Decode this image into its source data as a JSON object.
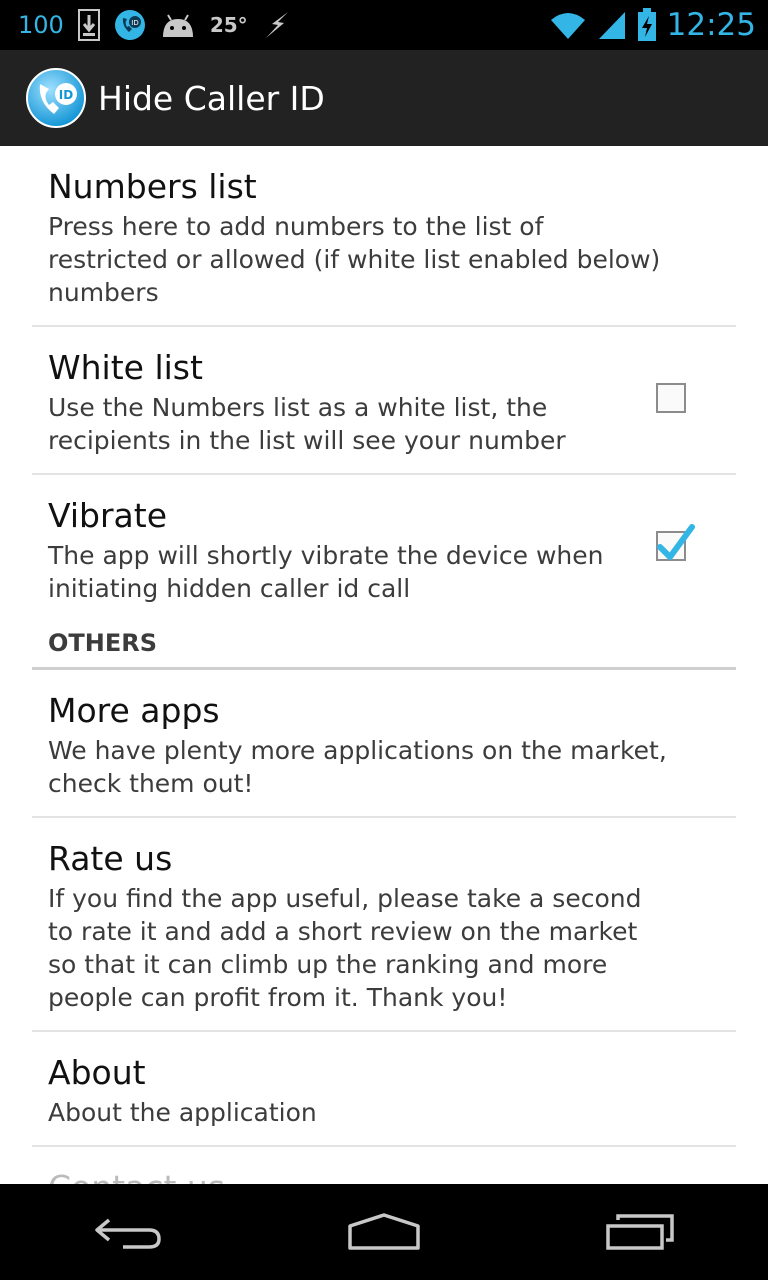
{
  "status_bar": {
    "battery_level_text": "100",
    "temperature": "25°",
    "time": "12:25",
    "icons": [
      "battery-100-icon",
      "download-icon",
      "caller-id-notify-icon",
      "android-icon",
      "weather-temp",
      "lightning-icon",
      "wifi-icon",
      "signal-icon",
      "battery-charging-icon"
    ]
  },
  "action_bar": {
    "title": "Hide Caller ID",
    "icon": "caller-id-app-icon"
  },
  "preferences": {
    "numbers_list": {
      "title": "Numbers list",
      "summary": "Press here to add numbers to the list of restricted or allowed (if white list enabled below) numbers"
    },
    "white_list": {
      "title": "White list",
      "summary": "Use the Numbers list as a white list, the recipients in the list will see your number",
      "checked": false
    },
    "vibrate": {
      "title": "Vibrate",
      "summary": "The app will shortly vibrate the device when initiating hidden caller id call",
      "checked": true
    },
    "others_header": "OTHERS",
    "more_apps": {
      "title": "More apps",
      "summary": "We have plenty more applications on the market, check them out!"
    },
    "rate_us": {
      "title": "Rate us",
      "summary": "If you find the app useful, please take a second to rate it and add a short review on the market so that it can climb up the ranking and more people can profit from it. Thank you!"
    },
    "about": {
      "title": "About",
      "summary": "About the application"
    },
    "contact_us": {
      "title": "Contact us"
    }
  },
  "colors": {
    "accent": "#33b5e5",
    "action_bar_bg": "#222222",
    "status_bar_bg": "#000000"
  },
  "nav_bar": {
    "icons": [
      "back-icon",
      "home-icon",
      "recent-apps-icon"
    ]
  }
}
